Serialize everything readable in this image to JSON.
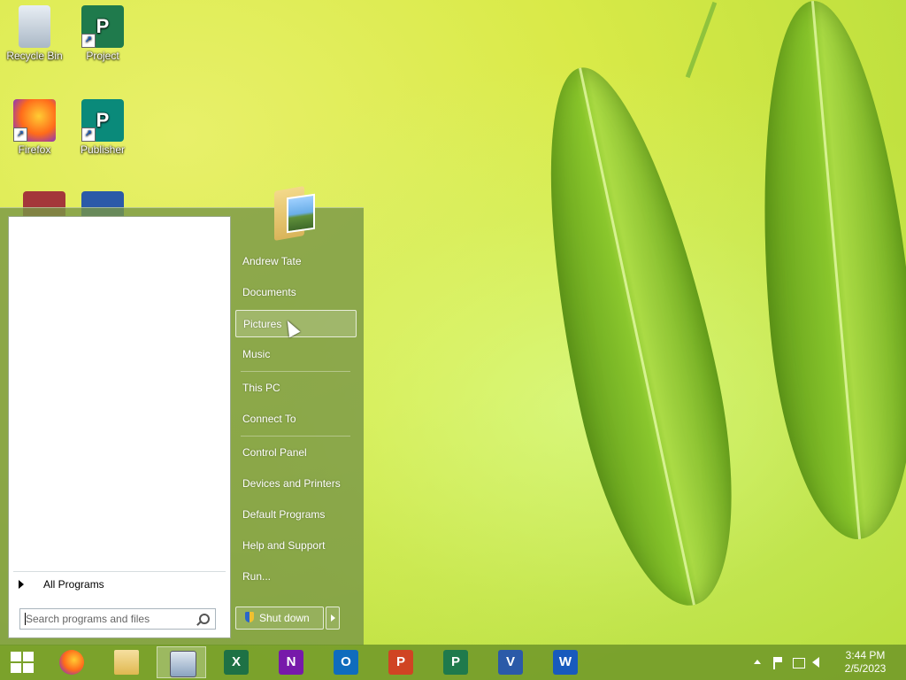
{
  "desktop_icons": [
    {
      "label": "Recycle Bin",
      "icon": "recycle-bin-icon"
    },
    {
      "label": "Project",
      "icon": "project-icon"
    },
    {
      "label": "Firefox",
      "icon": "firefox-icon"
    },
    {
      "label": "Publisher",
      "icon": "publisher-icon"
    },
    {
      "label": "",
      "icon": "access-icon"
    },
    {
      "label": "",
      "icon": "visio-icon"
    }
  ],
  "start_menu": {
    "all_programs": "All Programs",
    "search_placeholder": "Search programs and files",
    "right_items": [
      "Andrew Tate",
      "Documents",
      "Pictures",
      "Music",
      "This PC",
      "Connect To",
      "Control Panel",
      "Devices and Printers",
      "Default Programs",
      "Help and Support",
      "Run..."
    ],
    "highlighted_item": "Pictures",
    "shutdown_label": "Shut down"
  },
  "taskbar": {
    "apps": [
      "firefox",
      "file-explorer",
      "on-screen-keyboard",
      "excel",
      "onenote",
      "outlook",
      "powerpoint",
      "project",
      "visio",
      "word"
    ],
    "active_app": "on-screen-keyboard",
    "clock_time": "3:44 PM",
    "clock_date": "2/5/2023"
  },
  "colors": {
    "taskbar": "#6e9628",
    "excel": "#1e7145",
    "onenote": "#7719aa",
    "outlook": "#0f6cbd",
    "powerpoint": "#d04423",
    "project": "#1f7a4c",
    "visio": "#2b5aa8",
    "word": "#185abd"
  }
}
